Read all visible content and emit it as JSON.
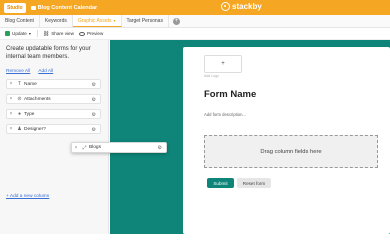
{
  "topbar": {
    "studio_label": "Studio",
    "base_title": "Blog Content Calendar",
    "brand_name": "stackby"
  },
  "tabs": [
    {
      "label": "Blog Content",
      "active": false
    },
    {
      "label": "Keywords",
      "active": false
    },
    {
      "label": "Graphic Assets",
      "active": true
    },
    {
      "label": "Target Personas",
      "active": false
    }
  ],
  "toolbar": {
    "update_label": "Update",
    "share_label": "Share view",
    "preview_label": "Preview"
  },
  "left_panel": {
    "title": "Create updatable forms for your internal team members.",
    "remove_all": "Remove All",
    "add_all": "Add All",
    "fields": [
      {
        "type_icon": "T",
        "name": "Name"
      },
      {
        "type_icon": "⊘",
        "name": "Attachments"
      },
      {
        "type_icon": "●",
        "name": "Type"
      },
      {
        "type_icon": "♟",
        "name": "Designer?"
      }
    ],
    "add_column": "+ Add a new column"
  },
  "dragged_field": {
    "type_icon": "⤢",
    "name": "Blogs"
  },
  "form": {
    "logo_button": "+",
    "logo_caption": "Add Logo",
    "name": "Form Name",
    "description_placeholder": "Add form description...",
    "dropzone_text": "Drag column fields here",
    "submit_label": "Submit",
    "reset_label": "Reset form"
  },
  "colors": {
    "brand": "#f5a623",
    "canvas": "#0e8578",
    "link": "#3b6fd3"
  }
}
